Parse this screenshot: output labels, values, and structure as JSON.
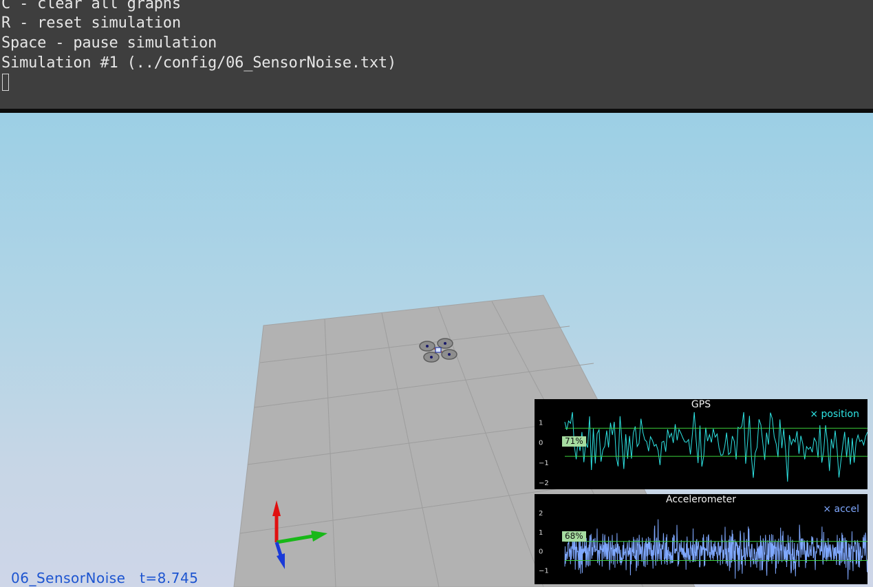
{
  "terminal": {
    "lines": [
      "C - clear all graphs",
      "R - reset simulation",
      "Space - pause simulation",
      "Simulation #1 (../config/06_SensorNoise.txt)"
    ]
  },
  "status": {
    "scenario": "06_SensorNoise",
    "time": "t=8.745"
  },
  "colors": {
    "terminal_bg": "#3e3e3e",
    "sky_top": "#9ccfe5",
    "sky_bottom": "#ced6e8",
    "floor": "#b0b0b0",
    "gps_series": "#2ee6e6",
    "accel_series": "#7fa8ff",
    "threshold": "#3cd23c",
    "badge": "#a6dca0",
    "status_text": "#1c54d0"
  },
  "axes_gizmo": {
    "icons": [
      "up-axis-arrow-red",
      "forward-axis-arrow-green",
      "down-axis-arrow-blue"
    ]
  },
  "graphs": {
    "gps": {
      "title": "GPS",
      "legend": "× position",
      "badge": "71%",
      "yticks": [
        "1",
        "0",
        "−1",
        "−2"
      ],
      "chart_data": {
        "type": "line",
        "ylim": [
          -2.2,
          1.6
        ],
        "ytick_values": [
          1,
          0,
          -1,
          -2
        ],
        "threshold_lines": [
          0.7,
          -0.7
        ],
        "seed": 7,
        "points": 160,
        "noise_sigma": 0.7
      }
    },
    "accel": {
      "title": "Accelerometer",
      "legend": "× accel",
      "badge": "68%",
      "yticks": [
        "2",
        "1",
        "0",
        "−1"
      ],
      "chart_data": {
        "type": "line",
        "ylim": [
          -1.6,
          2.4
        ],
        "ytick_values": [
          2,
          1,
          0,
          -1
        ],
        "threshold_lines": [
          0.5,
          -0.5
        ],
        "seed": 13,
        "points": 900,
        "noise_sigma": 0.5
      }
    }
  }
}
